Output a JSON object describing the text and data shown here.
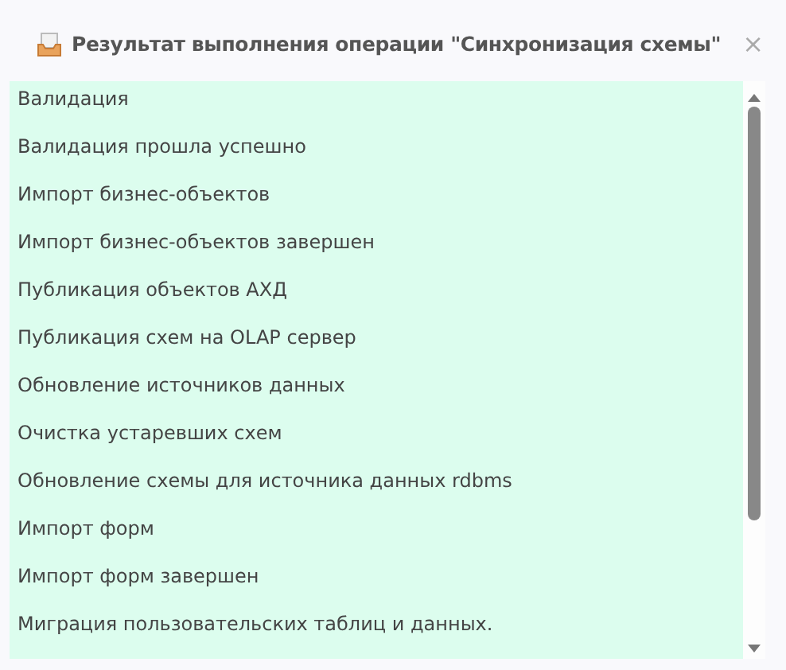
{
  "window": {
    "title": "Результат выполнения операции \"Синхронизация схемы\"",
    "close": "×"
  },
  "log": [
    {
      "text": "Валидация"
    },
    {
      "text": "Валидация прошла успешно"
    },
    {
      "text": "Импорт бизнес-объектов"
    },
    {
      "text": "Импорт бизнес-объектов завершен"
    },
    {
      "text": "Публикация объектов АХД"
    },
    {
      "text": "Публикация схем на OLAP сервер"
    },
    {
      "text": "Обновление источников данных"
    },
    {
      "text": "Очистка устаревших схем"
    },
    {
      "text": "Обновление схемы для источника данных rdbms"
    },
    {
      "text": "Импорт форм"
    },
    {
      "text": "Импорт форм завершен"
    },
    {
      "text": "Миграция пользовательских таблиц и данных."
    }
  ]
}
